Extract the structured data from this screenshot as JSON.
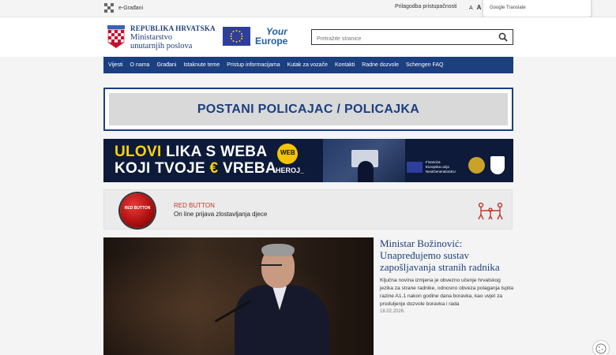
{
  "topbar": {
    "egradani_label": "e-Građani",
    "accessibility_label": "Prilagodba pristupačnosti",
    "font_small": "A",
    "font_large": "A",
    "google_translate_label": "Google Translate"
  },
  "header": {
    "ministry_line1": "REPUBLIKA HRVATSKA",
    "ministry_line2": "Ministarstvo",
    "ministry_line3": "unutarnjih poslova",
    "youreurope_line1": "Your",
    "youreurope_line2": "Europe",
    "search_placeholder": "Pretražite stranice"
  },
  "nav": {
    "items": [
      "Vijesti",
      "O nama",
      "Građani",
      "Istaknute teme",
      "Pristup informacijama",
      "Kutak za vozače",
      "Kontakti",
      "Radne dozvole",
      "Schengen FAQ"
    ]
  },
  "policajac_banner": {
    "text": "POSTANI POLICAJAC / POLICAJKA"
  },
  "web_banner": {
    "line1_a": "ULOVI",
    "line1_b": " LIKA S WEBA",
    "line2_a": "KOJI TVOJE ",
    "line2_b": "€",
    "line2_c": " VREBA",
    "badge_top": "WEB",
    "badge_bottom": "HEROJ_",
    "funds_line1": "Financira",
    "funds_line2": "Europska unija",
    "funds_line3": "NextGenerationEU"
  },
  "red_button": {
    "ball_text": "RED BUTTON",
    "title": "RED BUTTON",
    "subtitle": "On line prijava  zlostavljanja djece"
  },
  "news": {
    "headline": "Ministar Božinović: Unapređujemo sustav zapošljavanja stranih radnika",
    "lead": "Ključna novina izmjena je obvezno učenje hrvatskog jezika za strane radnike, odnosno obveza polaganja ispita razine A1.1 nakon godine dana boravka, kao uvjet za produljenje dozvole boravka i rada",
    "date": "18.02.2026."
  },
  "colors": {
    "brand_blue": "#1b3f7f",
    "accent_yellow": "#ffd400",
    "red": "#c0392b"
  }
}
